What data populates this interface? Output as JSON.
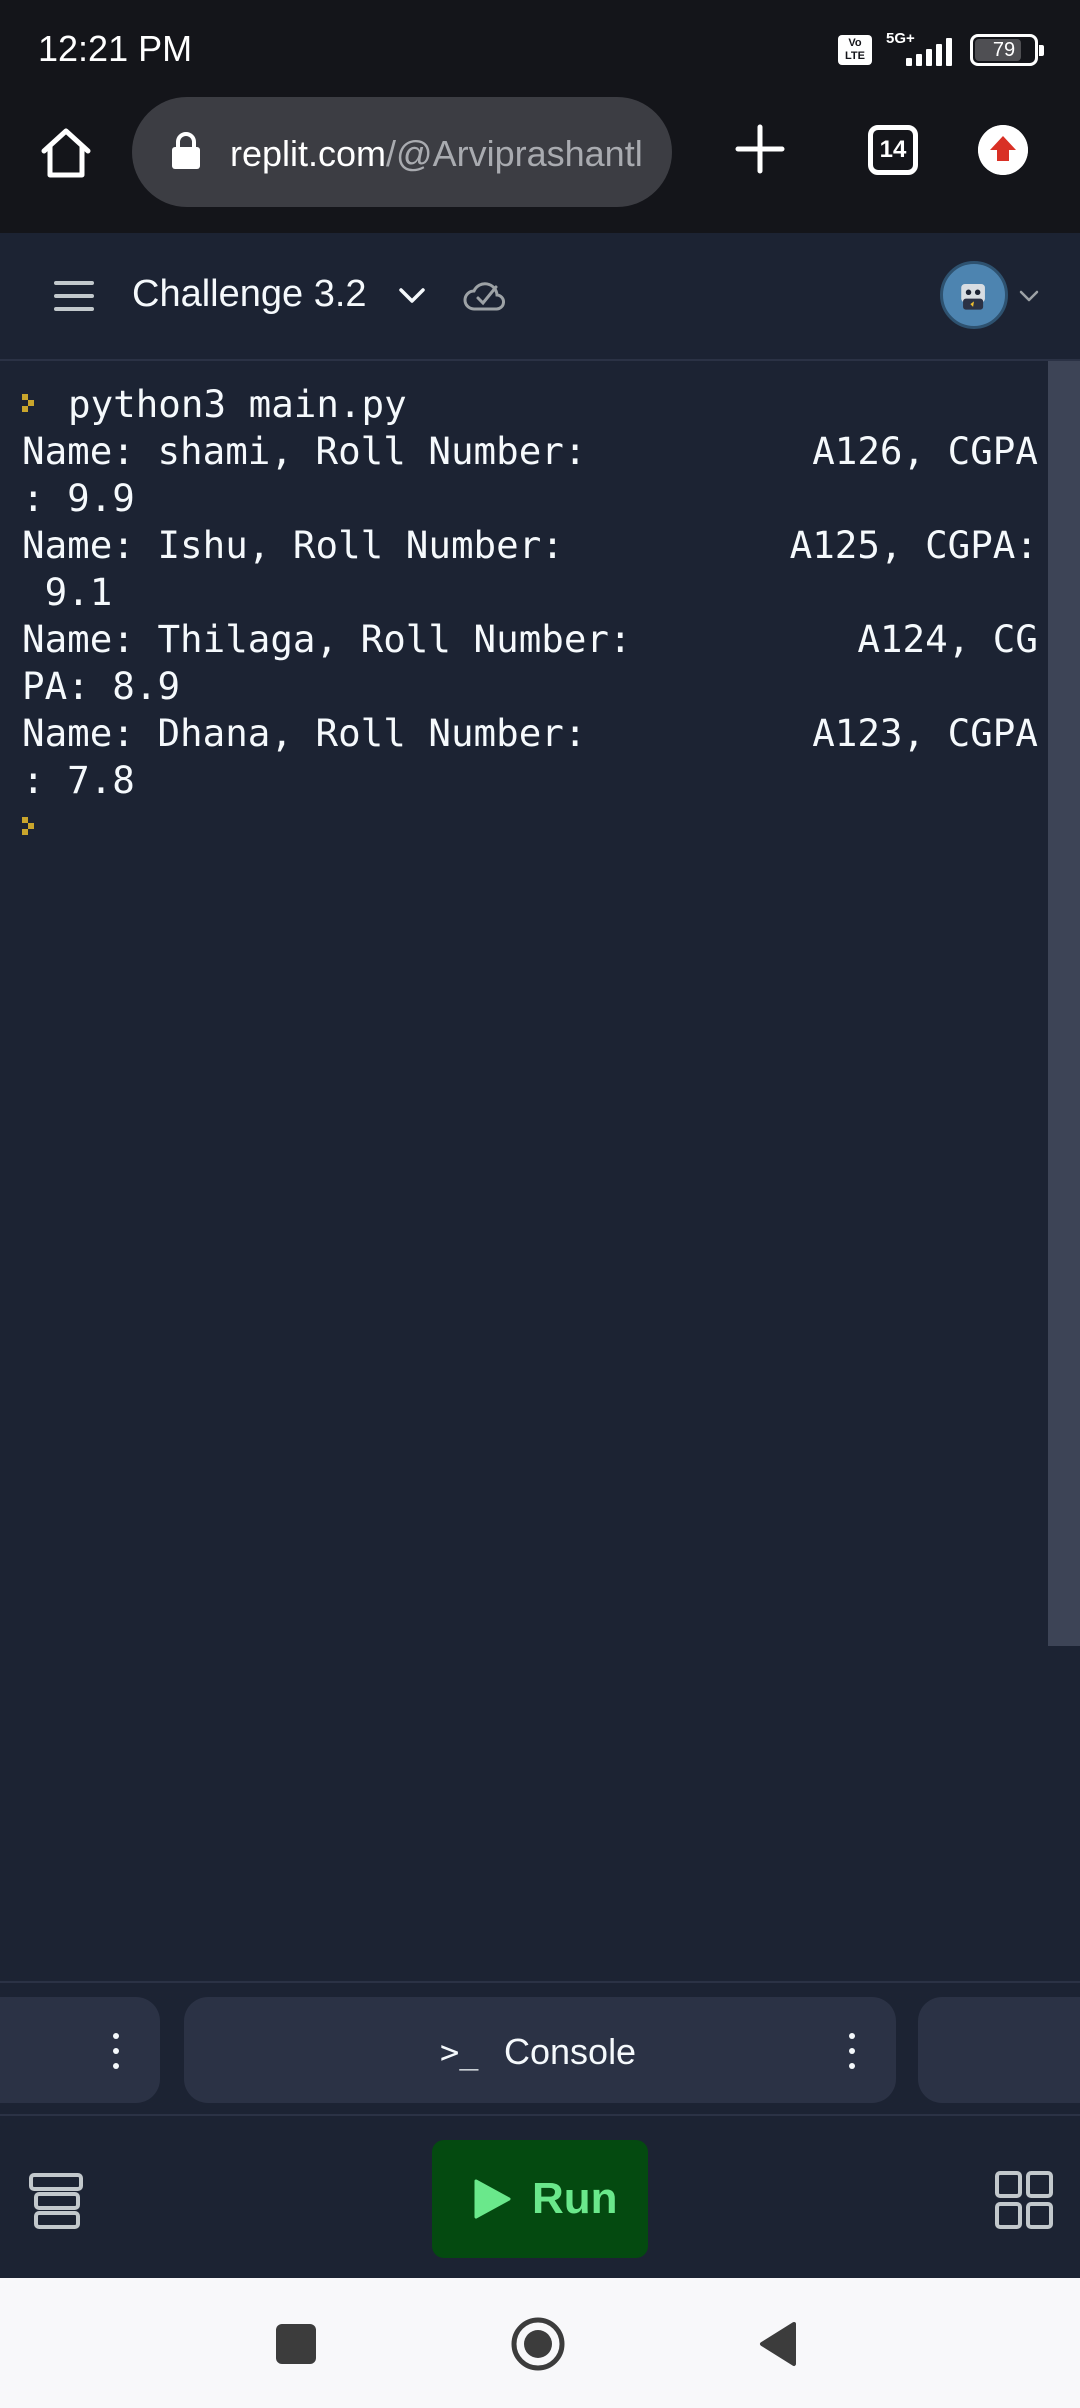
{
  "status_bar": {
    "time": "12:21 PM",
    "volte": "Vo LTE",
    "network": "5G+",
    "battery": "79",
    "battery_level": 0.79
  },
  "browser": {
    "url_host": "replit.com",
    "url_path": "/@Arviprashantl",
    "tab_count": "14"
  },
  "repl": {
    "title": "Challenge 3.2"
  },
  "console": {
    "lines": [
      "python3 main.py",
      "Name: shami, Roll Number:          A126, CGPA",
      ": 9.9",
      "Name: Ishu, Roll Number:          A125, CGPA:",
      " 9.1",
      "Name: Thilaga, Roll Number:          A124, CG",
      "PA: 8.9",
      "Name: Dhana, Roll Number:          A123, CGPA",
      ": 7.8"
    ]
  },
  "tabs": {
    "console_label": "Console",
    "console_icon": ">_"
  },
  "run_bar": {
    "run_label": "Run"
  },
  "colors": {
    "background": "#1c2333",
    "prompt": "#c9a52c",
    "run_bg": "#044a10",
    "run_text": "#6ae88b"
  },
  "icons": [
    "home-icon",
    "lock-icon",
    "plus-icon",
    "tabs-icon",
    "update-icon",
    "hamburger-icon",
    "chevron-down-icon",
    "cloud-check-icon",
    "avatar",
    "kebab-icon",
    "terminal-icon",
    "files-icon",
    "play-icon",
    "grid-icon",
    "recents-icon",
    "home-circle-icon",
    "back-icon"
  ]
}
